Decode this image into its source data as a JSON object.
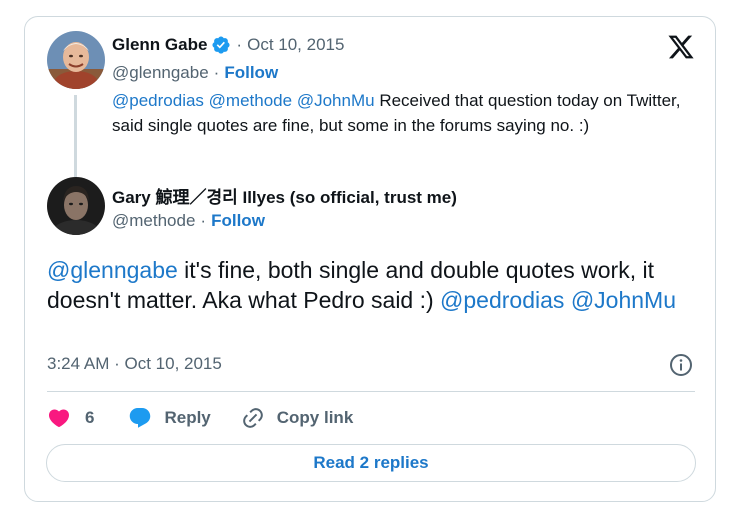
{
  "parent_tweet": {
    "author_name": "Glenn Gabe",
    "verified": true,
    "date": "Oct 10, 2015",
    "handle": "@glenngabe",
    "follow_label": "Follow",
    "mentions": [
      "@pedrodias",
      "@methode",
      "@JohnMu"
    ],
    "text": "Received that question today on Twitter, said single quotes are fine, but some in the forums saying no. :)"
  },
  "main_tweet": {
    "author_name": "Gary 鯨理／경리 Illyes (so official, trust me)",
    "handle": "@methode",
    "follow_label": "Follow",
    "text_mention_1": "@glenngabe",
    "text_body": " it's fine, both single and double quotes work, it doesn't matter. Aka what Pedro said :) ",
    "text_mention_2": "@pedrodias",
    "text_mention_3": "@JohnMu",
    "time": "3:24 AM",
    "date": "Oct 10, 2015"
  },
  "actions": {
    "like_count": "6",
    "reply_label": "Reply",
    "copy_link_label": "Copy link"
  },
  "read_replies_label": "Read 2 replies",
  "icons": {
    "logo": "x-logo-icon",
    "verified": "verified-badge-icon",
    "info": "info-icon",
    "like": "heart-icon",
    "reply": "speech-bubble-icon",
    "copy": "link-icon"
  },
  "colors": {
    "link": "#1d78c9",
    "muted": "#536471",
    "like": "#f91880",
    "reply": "#1d9bf0",
    "border": "#cfd9de"
  }
}
